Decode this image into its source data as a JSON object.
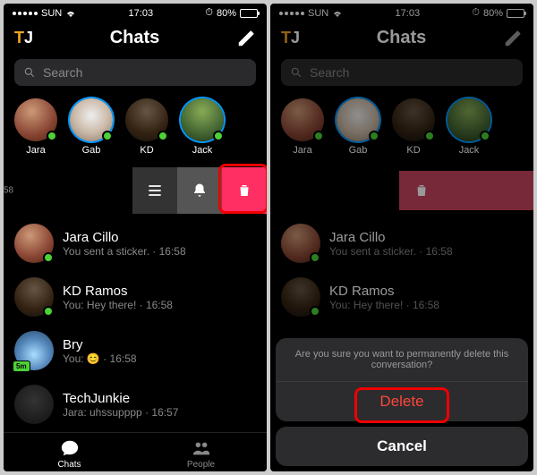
{
  "status": {
    "carrier": "SUN",
    "time": "17:03",
    "battery_pct": "80%"
  },
  "header": {
    "logo_t": "T",
    "logo_j": "J",
    "title": "Chats"
  },
  "search": {
    "placeholder": "Search"
  },
  "stories": [
    {
      "name": "Jara",
      "online": true,
      "ring": false
    },
    {
      "name": "Gab",
      "online": true,
      "ring": true
    },
    {
      "name": "KD",
      "online": true,
      "ring": false
    },
    {
      "name": "Jack",
      "online": true,
      "ring": true
    }
  ],
  "swipe_peek_time": "58",
  "chats": [
    {
      "name": "Jara Cillo",
      "msg": "You sent a sticker. · 16:58",
      "online": true
    },
    {
      "name": "KD Ramos",
      "msg": "You: Hey there! · 16:58",
      "online": true
    },
    {
      "name": "Bry",
      "msg": "You: 😊 · 16:58",
      "time_badge": "5m"
    },
    {
      "name": "TechJunkie",
      "msg": "Jara: uhssupppp · 16:57",
      "online": false
    }
  ],
  "nav": {
    "chats": "Chats",
    "people": "People"
  },
  "sheet": {
    "prompt": "Are you sure you want to permanently delete this conversation?",
    "delete": "Delete",
    "cancel": "Cancel"
  }
}
